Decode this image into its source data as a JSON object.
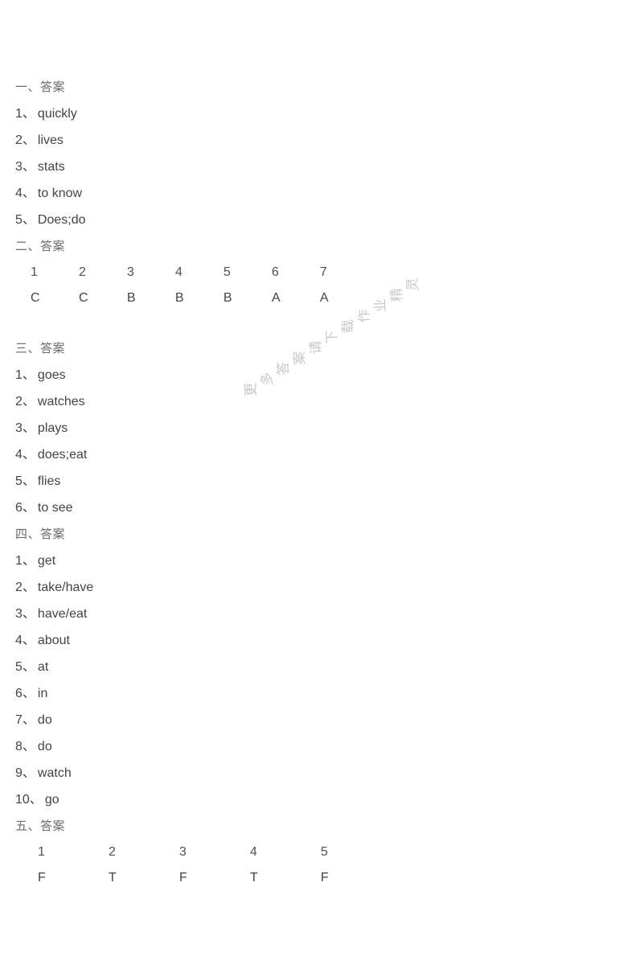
{
  "page": {
    "background_color": "#ffffff",
    "text_color": "#444444",
    "header_color": "#6b6b6b"
  },
  "watermark": {
    "text": "更多答案请下载作业精灵",
    "color": "#c9c9c9"
  },
  "sections": [
    {
      "header": "一、答案",
      "type": "list",
      "items": [
        {
          "num": "1",
          "sep": "、",
          "value": "quickly"
        },
        {
          "num": "2",
          "sep": "、",
          "value": "lives"
        },
        {
          "num": "3",
          "sep": "、",
          "value": "stats"
        },
        {
          "num": "4",
          "sep": "、",
          "value": "to know"
        },
        {
          "num": "5",
          "sep": "、",
          "value": "Does;do"
        }
      ]
    },
    {
      "header": "二、答案",
      "type": "grid",
      "columns": [
        "1",
        "2",
        "3",
        "4",
        "5",
        "6",
        "7"
      ],
      "answers": [
        "C",
        "C",
        "B",
        "B",
        "B",
        "A",
        "A"
      ]
    },
    {
      "header": "三、答案",
      "type": "list",
      "items": [
        {
          "num": "1",
          "sep": "、",
          "value": "goes"
        },
        {
          "num": "2",
          "sep": "、",
          "value": "watches"
        },
        {
          "num": "3",
          "sep": "、",
          "value": "plays"
        },
        {
          "num": "4",
          "sep": "、",
          "value": "does;eat"
        },
        {
          "num": "5",
          "sep": "、",
          "value": "flies"
        },
        {
          "num": "6",
          "sep": "、",
          "value": "to see"
        }
      ]
    },
    {
      "header": "四、答案",
      "type": "list",
      "items": [
        {
          "num": "1",
          "sep": "、",
          "value": "get"
        },
        {
          "num": "2",
          "sep": "、",
          "value": "take/have"
        },
        {
          "num": "3",
          "sep": "、",
          "value": "have/eat"
        },
        {
          "num": "4",
          "sep": "、",
          "value": "about"
        },
        {
          "num": "5",
          "sep": "、",
          "value": "at"
        },
        {
          "num": "6",
          "sep": "、",
          "value": "in"
        },
        {
          "num": "7",
          "sep": "、",
          "value": "do"
        },
        {
          "num": "8",
          "sep": "、",
          "value": "do"
        },
        {
          "num": "9",
          "sep": "、",
          "value": "watch"
        },
        {
          "num": "10",
          "sep": "、",
          "value": "go"
        }
      ]
    },
    {
      "header": "五、答案",
      "type": "grid",
      "columns": [
        "1",
        "2",
        "3",
        "4",
        "5"
      ],
      "answers": [
        "F",
        "T",
        "F",
        "T",
        "F"
      ]
    }
  ]
}
